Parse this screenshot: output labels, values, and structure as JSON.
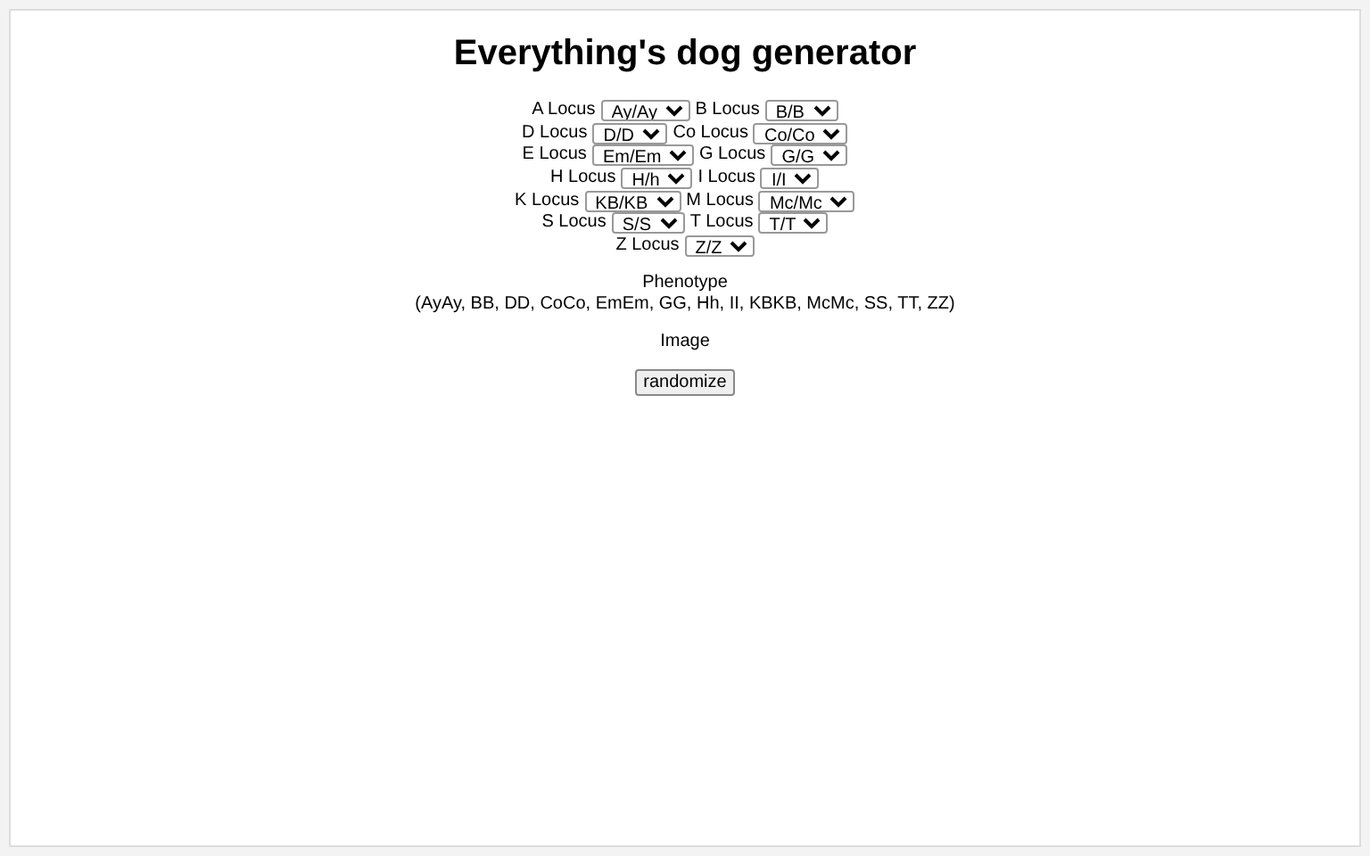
{
  "title": "Everything's dog generator",
  "loci_rows": [
    [
      {
        "label": "A Locus",
        "value": "Ay/Ay"
      },
      {
        "label": "B Locus",
        "value": "B/B"
      }
    ],
    [
      {
        "label": "D Locus",
        "value": "D/D"
      },
      {
        "label": "Co Locus",
        "value": "Co/Co"
      }
    ],
    [
      {
        "label": "E Locus",
        "value": "Em/Em"
      },
      {
        "label": "G Locus",
        "value": "G/G"
      }
    ],
    [
      {
        "label": "H Locus",
        "value": "H/h"
      },
      {
        "label": "I Locus",
        "value": "I/I"
      }
    ],
    [
      {
        "label": "K Locus",
        "value": "KB/KB"
      },
      {
        "label": "M Locus",
        "value": "Mc/Mc"
      }
    ],
    [
      {
        "label": "S Locus",
        "value": "S/S"
      },
      {
        "label": "T Locus",
        "value": "T/T"
      }
    ],
    [
      {
        "label": "Z Locus",
        "value": "Z/Z"
      }
    ]
  ],
  "phenotype_heading": "Phenotype",
  "phenotype": "(AyAy, BB, DD, CoCo, EmEm, GG, Hh, II, KBKB, McMc, SS, TT, ZZ)",
  "image_label": "Image",
  "randomize_button": "randomize"
}
